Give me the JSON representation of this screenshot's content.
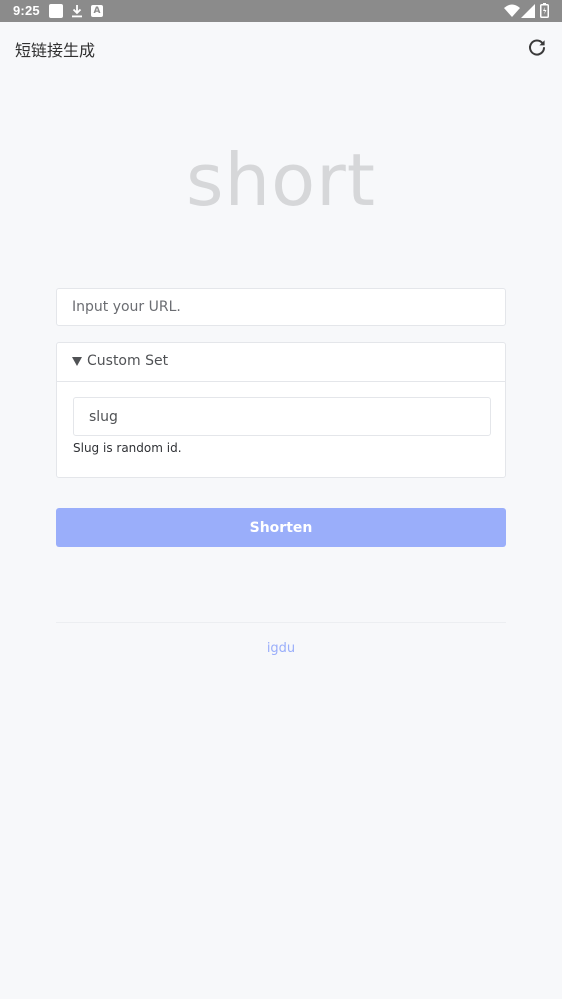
{
  "status_bar": {
    "time": "9:25",
    "icons": [
      "square-icon",
      "download-icon",
      "a-icon",
      "wifi-icon",
      "signal-icon",
      "battery-icon"
    ],
    "a_glyph": "A"
  },
  "app_bar": {
    "title": "短链接生成",
    "refresh_icon": "refresh-icon"
  },
  "main": {
    "logo": "short",
    "url_input": {
      "placeholder": "Input your URL.",
      "value": ""
    },
    "custom_set": {
      "title": "Custom Set",
      "expanded": true,
      "slug_input": {
        "placeholder": "slug",
        "value": ""
      },
      "hint": "Slug is random id."
    },
    "shorten_label": "Shorten"
  },
  "footer": {
    "link_text": "igdu"
  },
  "colors": {
    "background": "#f7f8fa",
    "accent": "#9aaefa",
    "logo": "#d6d7d9",
    "status_bar": "#8b8b8b"
  }
}
